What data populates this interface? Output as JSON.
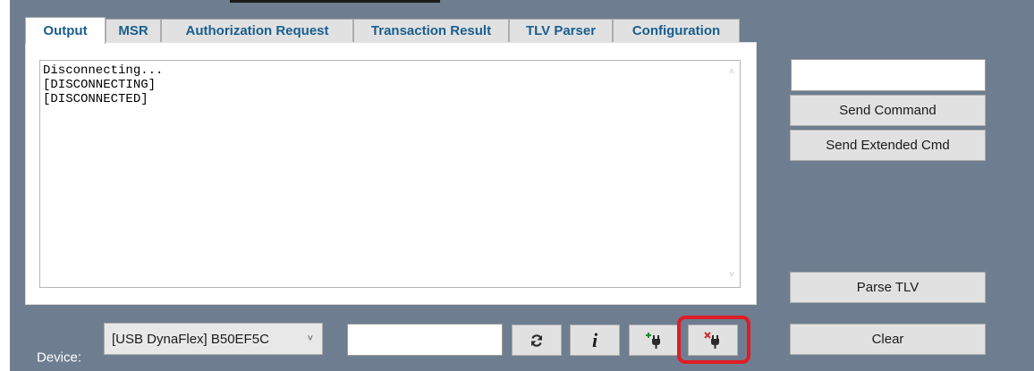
{
  "tabs": [
    {
      "label": "Output",
      "active": true
    },
    {
      "label": "MSR",
      "active": false
    },
    {
      "label": "Authorization Request",
      "active": false
    },
    {
      "label": "Transaction Result",
      "active": false
    },
    {
      "label": "TLV Parser",
      "active": false
    },
    {
      "label": "Configuration",
      "active": false
    }
  ],
  "output": {
    "text": "Disconnecting...\n[DISCONNECTING]\n[DISCONNECTED]"
  },
  "side_panel": {
    "command_input_value": "",
    "send_command_label": "Send Command",
    "send_extended_label": "Send Extended Cmd",
    "parse_tlv_label": "Parse TLV",
    "clear_label": "Clear"
  },
  "device_bar": {
    "device_label": "Device:",
    "selected_device": "[USB DynaFlex] B50EF5C",
    "secondary_input_value": "",
    "info_label": "i",
    "icons": [
      "refresh-icon",
      "info-icon",
      "connect-icon",
      "disconnect-icon"
    ]
  },
  "colors": {
    "window_bg": "#6e7e90",
    "tab_text": "#195e8f",
    "highlight": "#e01c24"
  }
}
